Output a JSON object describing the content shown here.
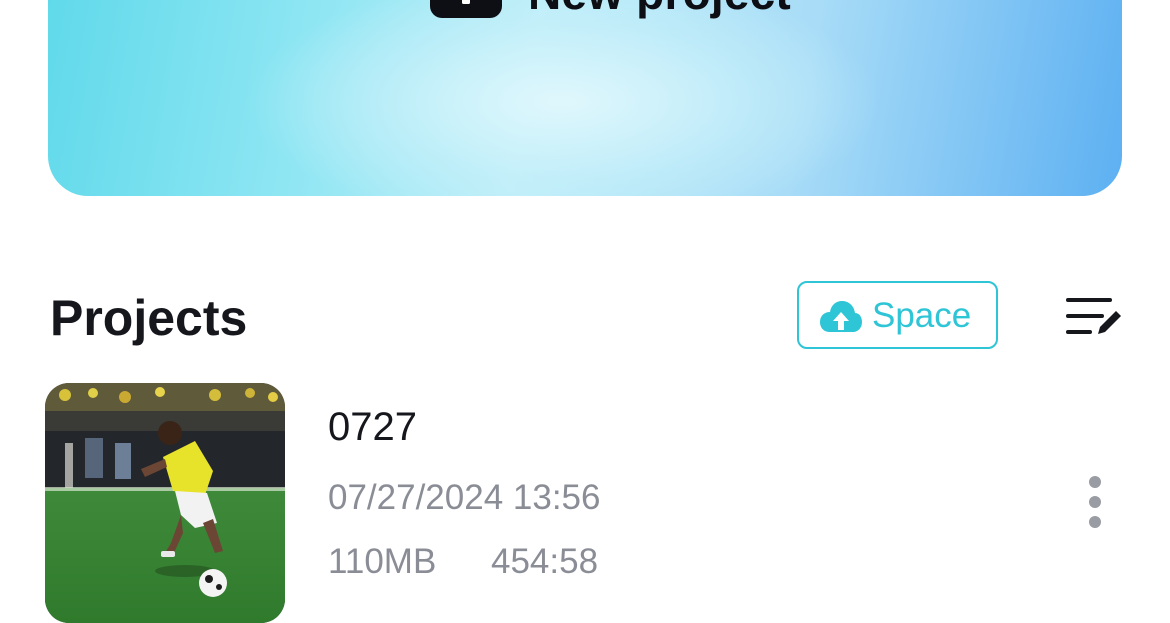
{
  "new_project": {
    "label": "New project",
    "icon": "plus-square-icon"
  },
  "projects_section": {
    "title": "Projects",
    "space_button": {
      "label": "Space",
      "icon": "cloud-upload-icon",
      "color": "#2ec5d6"
    },
    "sort_icon": "sort-edit-icon"
  },
  "projects": [
    {
      "name": "0727",
      "date": "07/27/2024 13:56",
      "size": "110MB",
      "duration": "454:58",
      "thumbnail_icon": "video-thumbnail",
      "more_icon": "more-vertical-icon"
    }
  ]
}
